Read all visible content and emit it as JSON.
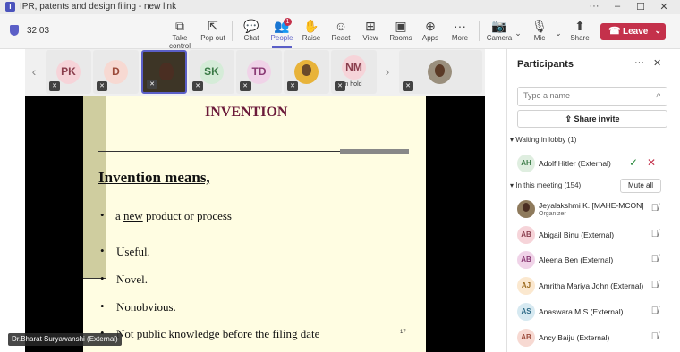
{
  "window": {
    "title": "IPR, patents and design filing - new link",
    "app_icon": "T"
  },
  "toolbar": {
    "timer": "32:03",
    "buttons": [
      {
        "label": "Take control",
        "icon": "take-control-icon"
      },
      {
        "label": "Pop out",
        "icon": "pop-out-icon"
      },
      {
        "label": "Chat",
        "icon": "chat-icon"
      },
      {
        "label": "People",
        "icon": "people-icon",
        "badge": "1",
        "active": true
      },
      {
        "label": "Raise",
        "icon": "hand-icon"
      },
      {
        "label": "React",
        "icon": "react-icon"
      },
      {
        "label": "View",
        "icon": "view-icon"
      },
      {
        "label": "Rooms",
        "icon": "rooms-icon"
      },
      {
        "label": "Apps",
        "icon": "apps-icon"
      },
      {
        "label": "More",
        "icon": "more-icon"
      },
      {
        "label": "Camera",
        "icon": "camera-off-icon"
      },
      {
        "label": "Mic",
        "icon": "mic-off-icon"
      },
      {
        "label": "Share",
        "icon": "share-icon"
      }
    ],
    "leave_label": "Leave",
    "accent": "#5b5fc7",
    "leave_color": "#c4314b"
  },
  "tiles": [
    {
      "initials": "PK",
      "bg": "#f6d4d9",
      "fg": "#8a3e4d"
    },
    {
      "initials": "D",
      "bg": "#f7d9d2",
      "fg": "#9b4a3a"
    },
    {
      "initials": "",
      "video": true
    },
    {
      "initials": "SK",
      "bg": "#d5ecd8",
      "fg": "#3a7a46"
    },
    {
      "initials": "TD",
      "bg": "#f0d3e8",
      "fg": "#8a3a74"
    },
    {
      "initials": "",
      "photo": true
    },
    {
      "initials": "NM",
      "bg": "#f6d4d9",
      "fg": "#8a3e4d",
      "status": "On hold"
    },
    {
      "initials": "",
      "photo2": true
    }
  ],
  "slide": {
    "title": "INVENTION",
    "heading": "Invention means,",
    "bullets": [
      {
        "pre": "a ",
        "em": "new",
        "post": " product or process"
      },
      {
        "pre": "Useful.",
        "em": "",
        "post": ""
      },
      {
        "pre": "Novel.",
        "em": "",
        "post": ""
      },
      {
        "pre": "Nonobvious.",
        "em": "",
        "post": ""
      },
      {
        "pre": "Not public knowledge before the filing date",
        "em": "",
        "post": ""
      }
    ],
    "page_number": "17",
    "presenter": "Dr.Bharat Suryawanshi (External)"
  },
  "panel": {
    "title": "Participants",
    "search_placeholder": "Type a name",
    "share_invite": "Share invite",
    "lobby_header": "Waiting in lobby (1)",
    "lobby": [
      {
        "initials": "AH",
        "name": "Adolf Hitler (External)",
        "bg": "#dfeee0",
        "fg": "#3a7a46"
      }
    ],
    "meeting_header": "In this meeting (154)",
    "mute_all": "Mute all",
    "members": [
      {
        "initials": "",
        "name": "Jeyalakshmi K. [MAHE-MCON]",
        "role": "Organizer",
        "bg": "#c8b89a",
        "fg": "#333"
      },
      {
        "initials": "AB",
        "name": "Abigail Binu (External)",
        "role": "",
        "bg": "#f6d4d9",
        "fg": "#8a3e4d"
      },
      {
        "initials": "AB",
        "name": "Aleena Ben (External)",
        "role": "",
        "bg": "#f0d3e8",
        "fg": "#8a3a74"
      },
      {
        "initials": "AJ",
        "name": "Amritha Mariya John (External)",
        "role": "",
        "bg": "#fbe8cf",
        "fg": "#9b6a1e"
      },
      {
        "initials": "AS",
        "name": "Anaswara M S (External)",
        "role": "",
        "bg": "#d6e9f1",
        "fg": "#2e6a86"
      },
      {
        "initials": "AB",
        "name": "Ancy Baiju (External)",
        "role": "",
        "bg": "#f7d9d2",
        "fg": "#9b4a3a"
      }
    ]
  }
}
